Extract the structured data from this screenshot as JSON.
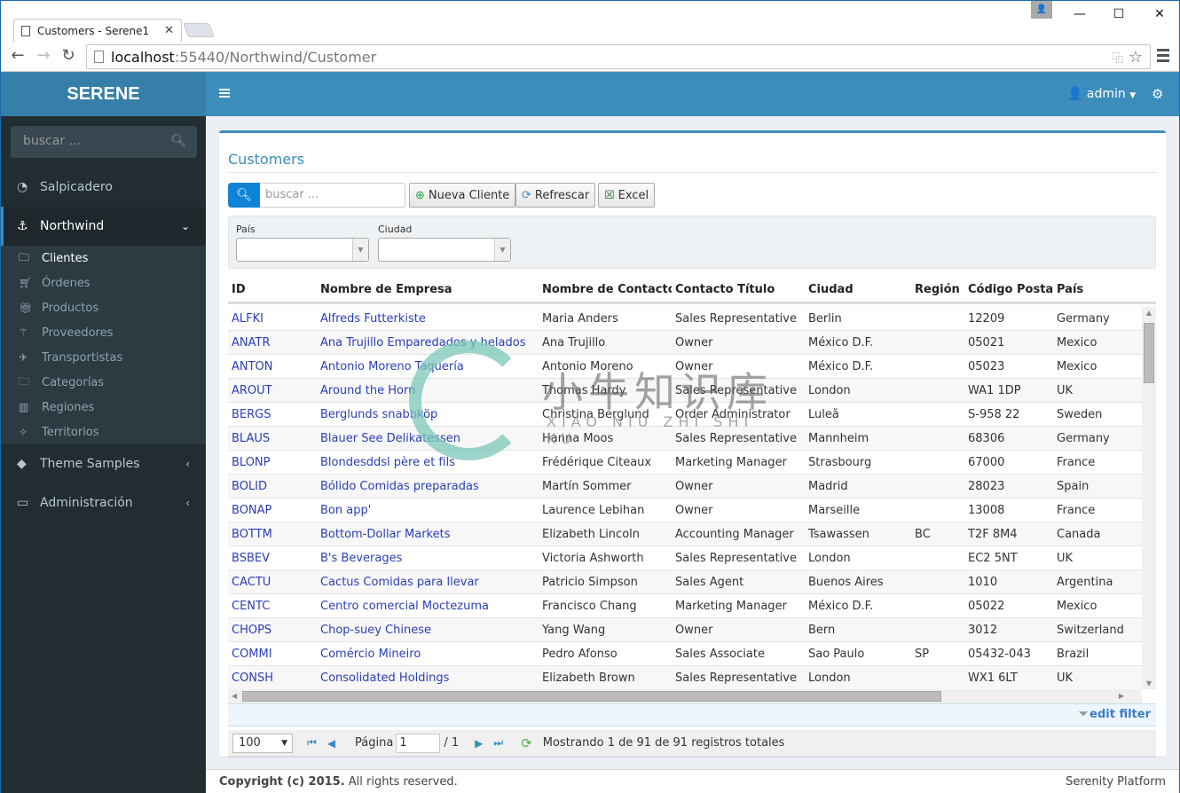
{
  "browser": {
    "tab_title": "Customers - Serene1",
    "url_host": "localhost",
    "url_path": ":55440/Northwind/Customer",
    "window_controls": {
      "minimize": "—",
      "maximize": "☐",
      "close": "✕"
    }
  },
  "header": {
    "logo": "SERENE",
    "user": "admin"
  },
  "sidebar": {
    "search_placeholder": "buscar ...",
    "items": [
      {
        "label": "Salpicadero",
        "icon": "dashboard-icon"
      },
      {
        "label": "Northwind",
        "icon": "anchor-icon",
        "expanded": true
      },
      {
        "label": "Theme Samples",
        "icon": "diamond-icon"
      },
      {
        "label": "Administración",
        "icon": "desktop-icon"
      }
    ],
    "subitems": [
      {
        "label": "Clientes",
        "icon": "folder-icon",
        "active": true
      },
      {
        "label": "Órdenes",
        "icon": "cart-icon"
      },
      {
        "label": "Productos",
        "icon": "gift-icon"
      },
      {
        "label": "Proveedores",
        "icon": "magic-wand-icon"
      },
      {
        "label": "Transportistas",
        "icon": "plane-icon"
      },
      {
        "label": "Categorías",
        "icon": "folder-icon"
      },
      {
        "label": "Regiones",
        "icon": "map-icon"
      },
      {
        "label": "Territorios",
        "icon": "puzzle-icon"
      }
    ]
  },
  "main": {
    "title": "Customers",
    "search_placeholder": "buscar ...",
    "buttons": {
      "new": "Nueva Cliente",
      "refresh": "Refrescar",
      "excel": "Excel"
    },
    "filters": {
      "country_label": "País",
      "country_value": "",
      "city_label": "Ciudad",
      "city_value": ""
    },
    "grid": {
      "columns": [
        "ID",
        "Nombre de Empresa",
        "Nombre de Contacto",
        "Contacto Título",
        "Ciudad",
        "Región",
        "Código Postal",
        "País"
      ],
      "rows": [
        [
          "ALFKI",
          "Alfreds Futterkiste",
          "Maria Anders",
          "Sales Representative",
          "Berlin",
          "",
          "12209",
          "Germany"
        ],
        [
          "ANATR",
          "Ana Trujillo Emparedados y helados",
          "Ana Trujillo",
          "Owner",
          "México D.F.",
          "",
          "05021",
          "Mexico"
        ],
        [
          "ANTON",
          "Antonio Moreno Taquería",
          "Antonio Moreno",
          "Owner",
          "México D.F.",
          "",
          "05023",
          "Mexico"
        ],
        [
          "AROUT",
          "Around the Horn",
          "Thomas Hardy",
          "Sales Representative",
          "London",
          "",
          "WA1 1DP",
          "UK"
        ],
        [
          "BERGS",
          "Berglunds snabbköp",
          "Christina Berglund",
          "Order Administrator",
          "Luleå",
          "",
          "S-958 22",
          "Sweden"
        ],
        [
          "BLAUS",
          "Blauer See Delikatessen",
          "Hanna Moos",
          "Sales Representative",
          "Mannheim",
          "",
          "68306",
          "Germany"
        ],
        [
          "BLONP",
          "Blondesddsl père et fils",
          "Frédérique Citeaux",
          "Marketing Manager",
          "Strasbourg",
          "",
          "67000",
          "France"
        ],
        [
          "BOLID",
          "Bólido Comidas preparadas",
          "Martín Sommer",
          "Owner",
          "Madrid",
          "",
          "28023",
          "Spain"
        ],
        [
          "BONAP",
          "Bon app'",
          "Laurence Lebihan",
          "Owner",
          "Marseille",
          "",
          "13008",
          "France"
        ],
        [
          "BOTTM",
          "Bottom-Dollar Markets",
          "Elizabeth Lincoln",
          "Accounting Manager",
          "Tsawassen",
          "BC",
          "T2F 8M4",
          "Canada"
        ],
        [
          "BSBEV",
          "B's Beverages",
          "Victoria Ashworth",
          "Sales Representative",
          "London",
          "",
          "EC2 5NT",
          "UK"
        ],
        [
          "CACTU",
          "Cactus Comidas para llevar",
          "Patricio Simpson",
          "Sales Agent",
          "Buenos Aires",
          "",
          "1010",
          "Argentina"
        ],
        [
          "CENTC",
          "Centro comercial Moctezuma",
          "Francisco Chang",
          "Marketing Manager",
          "México D.F.",
          "",
          "05022",
          "Mexico"
        ],
        [
          "CHOPS",
          "Chop-suey Chinese",
          "Yang Wang",
          "Owner",
          "Bern",
          "",
          "3012",
          "Switzerland"
        ],
        [
          "COMMI",
          "Comércio Mineiro",
          "Pedro Afonso",
          "Sales Associate",
          "Sao Paulo",
          "SP",
          "05432-043",
          "Brazil"
        ],
        [
          "CONSH",
          "Consolidated Holdings",
          "Elizabeth Brown",
          "Sales Representative",
          "London",
          "",
          "WX1 6LT",
          "UK"
        ]
      ]
    },
    "edit_filter": "edit filter",
    "pager": {
      "page_size": "100",
      "page_label": "Página",
      "page_value": "1",
      "page_of": "/ 1",
      "status": "Mostrando 1 de 91 de 91 registros totales"
    }
  },
  "footer": {
    "copyright_bold": "Copyright (c) 2015.",
    "copyright_rest": " All rights reserved.",
    "platform": "Serenity Platform"
  },
  "watermark": {
    "text": "小牛知识库",
    "subtext": "XIAO NIU ZHI SHI KU"
  }
}
